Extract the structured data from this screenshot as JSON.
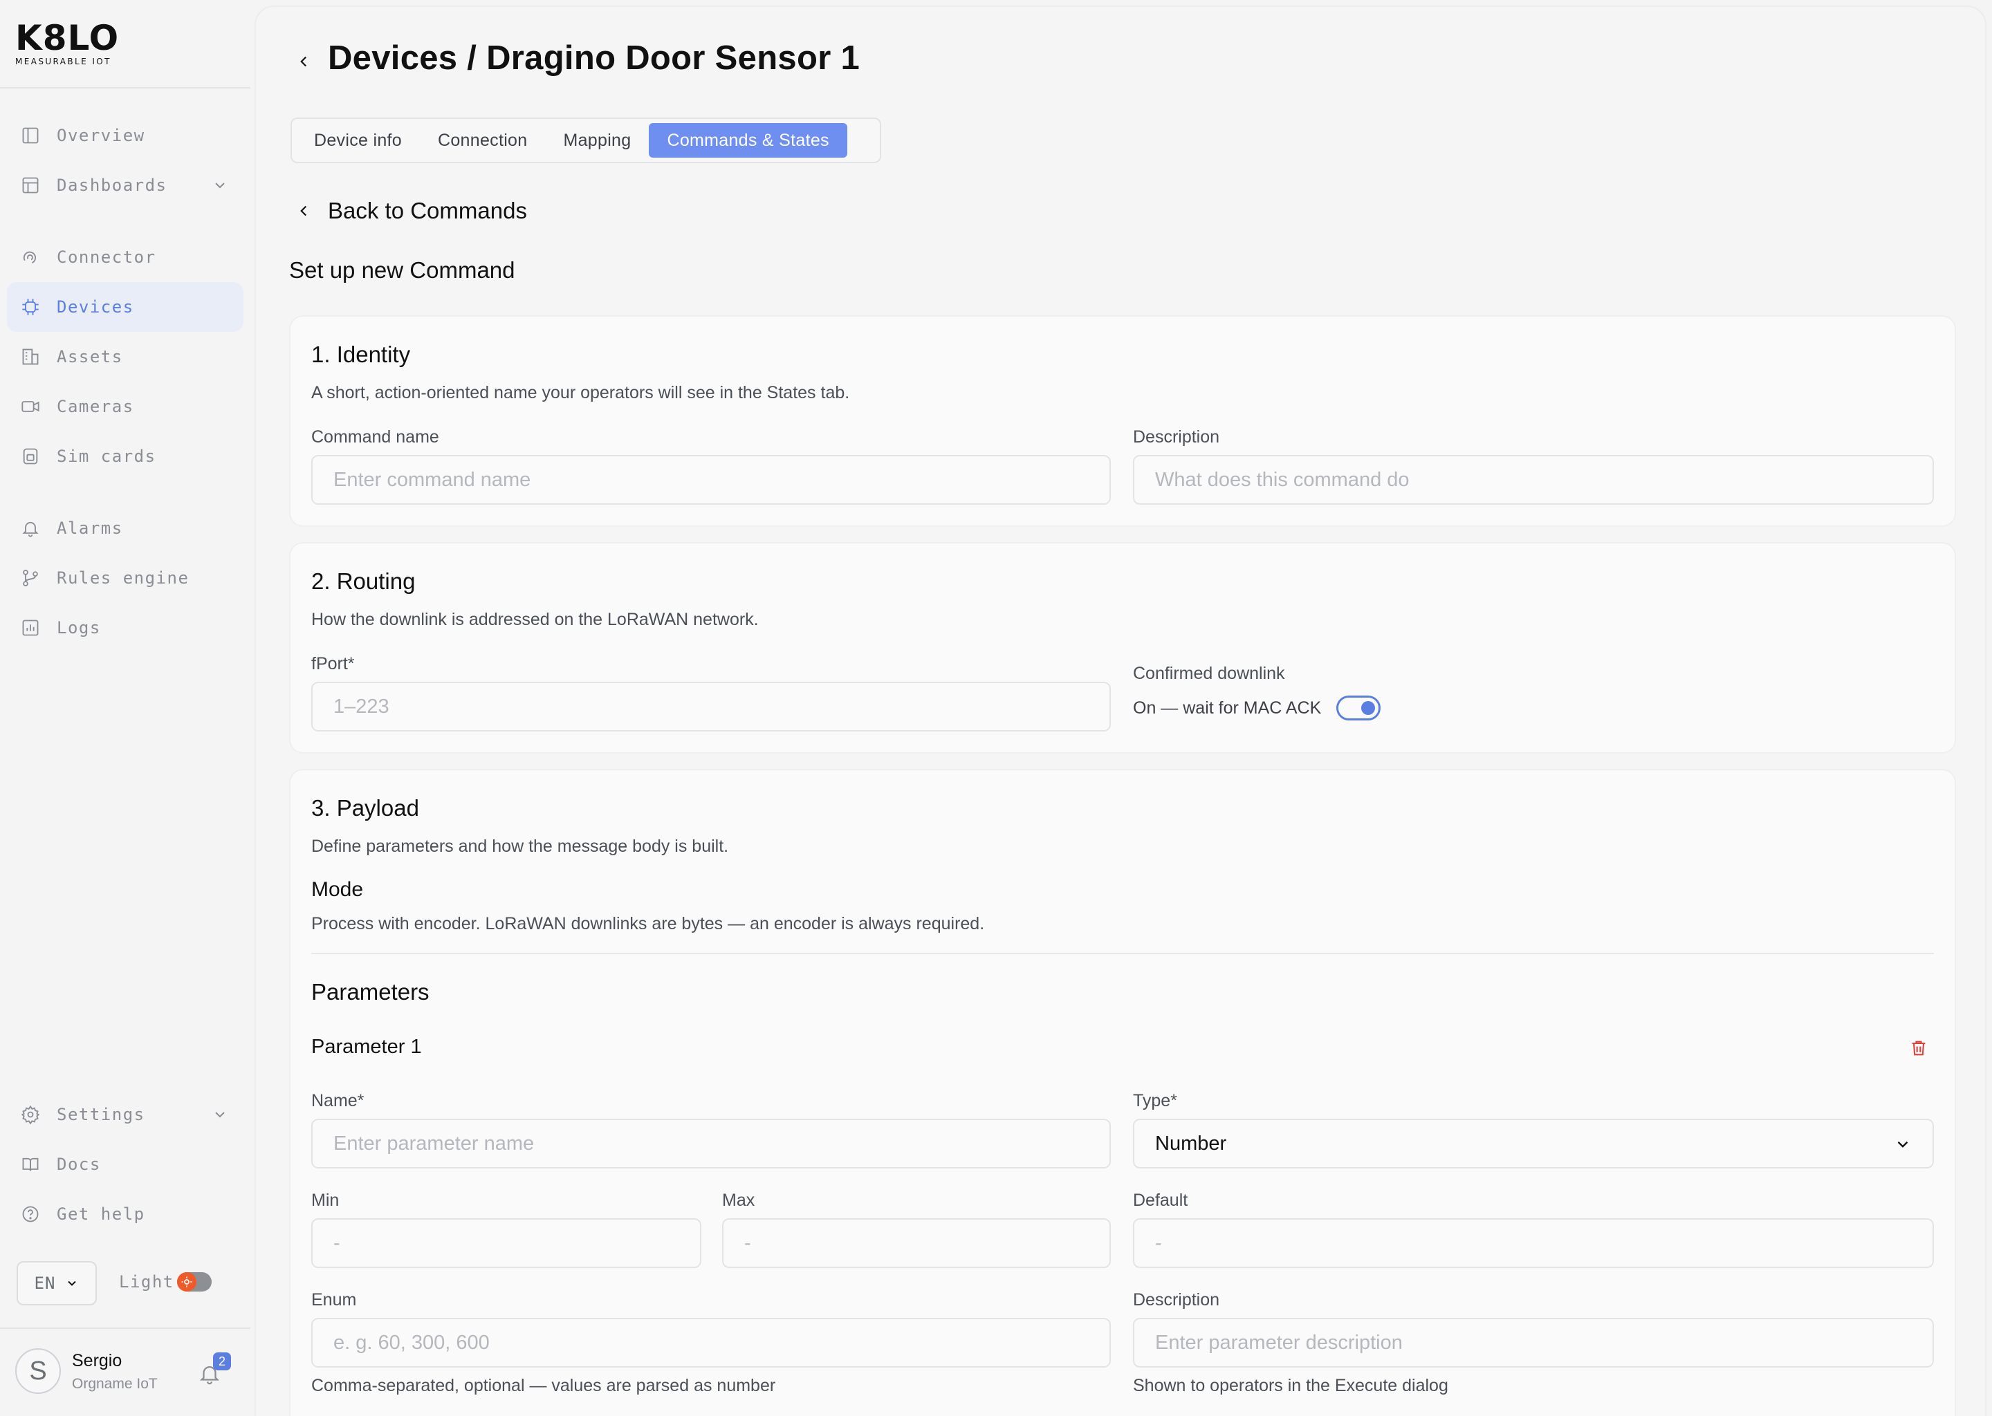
{
  "brand": {
    "logo_text": "K8LO",
    "tagline": "MEASURABLE IOT"
  },
  "sidebar": {
    "items": [
      {
        "label": "Overview",
        "icon": "layout-icon"
      },
      {
        "label": "Dashboards",
        "icon": "dashboard-icon"
      },
      {
        "label": "Connector",
        "icon": "connector-icon"
      },
      {
        "label": "Devices",
        "icon": "chip-icon",
        "active": true
      },
      {
        "label": "Assets",
        "icon": "building-icon"
      },
      {
        "label": "Cameras",
        "icon": "camera-icon"
      },
      {
        "label": "Sim cards",
        "icon": "sim-card-icon"
      },
      {
        "label": "Alarms",
        "icon": "bell-icon"
      },
      {
        "label": "Rules engine",
        "icon": "git-branch-icon"
      },
      {
        "label": "Logs",
        "icon": "chart-icon"
      }
    ],
    "bottom_items": [
      {
        "label": "Settings",
        "icon": "gear-icon"
      },
      {
        "label": "Docs",
        "icon": "book-icon"
      },
      {
        "label": "Get help",
        "icon": "help-icon"
      }
    ],
    "language": "EN",
    "theme_label": "Light",
    "user": {
      "initial": "S",
      "name": "Sergio",
      "org": "Orgname IoT",
      "notifications": "2"
    }
  },
  "header": {
    "title": "Devices / Dragino Door Sensor 1"
  },
  "tabs": [
    {
      "label": "Device info"
    },
    {
      "label": "Connection"
    },
    {
      "label": "Mapping"
    },
    {
      "label": "Commands & States",
      "active": true
    }
  ],
  "back_link": "Back to Commands",
  "form_title": "Set up new Command",
  "identity": {
    "title": "1. Identity",
    "subtitle": "A short, action-oriented name your operators will see in the States tab.",
    "command_name_label": "Command name",
    "command_name_placeholder": "Enter command name",
    "description_label": "Description",
    "description_placeholder": "What does this command do"
  },
  "routing": {
    "title": "2. Routing",
    "subtitle": "How the downlink is addressed on the LoRaWAN network.",
    "fport_label": "fPort*",
    "fport_placeholder": "1–223",
    "confirmed_label": "Confirmed downlink",
    "confirmed_text": "On — wait for MAC ACK",
    "confirmed_on": true
  },
  "payload": {
    "title": "3. Payload",
    "subtitle": "Define parameters and how the message body is built.",
    "mode_title": "Mode",
    "mode_text": "Process with encoder. LoRaWAN downlinks are bytes — an encoder is always required.",
    "parameters_title": "Parameters",
    "parameter": {
      "title": "Parameter 1",
      "name_label": "Name*",
      "name_placeholder": "Enter parameter name",
      "type_label": "Type*",
      "type_value": "Number",
      "min_label": "Min",
      "min_placeholder": "-",
      "max_label": "Max",
      "max_placeholder": "-",
      "default_label": "Default",
      "default_placeholder": "-",
      "enum_label": "Enum",
      "enum_placeholder": "e. g. 60, 300, 600",
      "enum_help": "Comma-separated, optional — values are parsed as number",
      "description_label": "Description",
      "description_placeholder": "Enter parameter description",
      "description_help": "Shown to operators in the Execute dialog"
    }
  },
  "colors": {
    "accent": "#5b7fe0",
    "tab_active": "#6e8ff0",
    "danger": "#e0403a",
    "theme_knob": "#f05a28"
  }
}
